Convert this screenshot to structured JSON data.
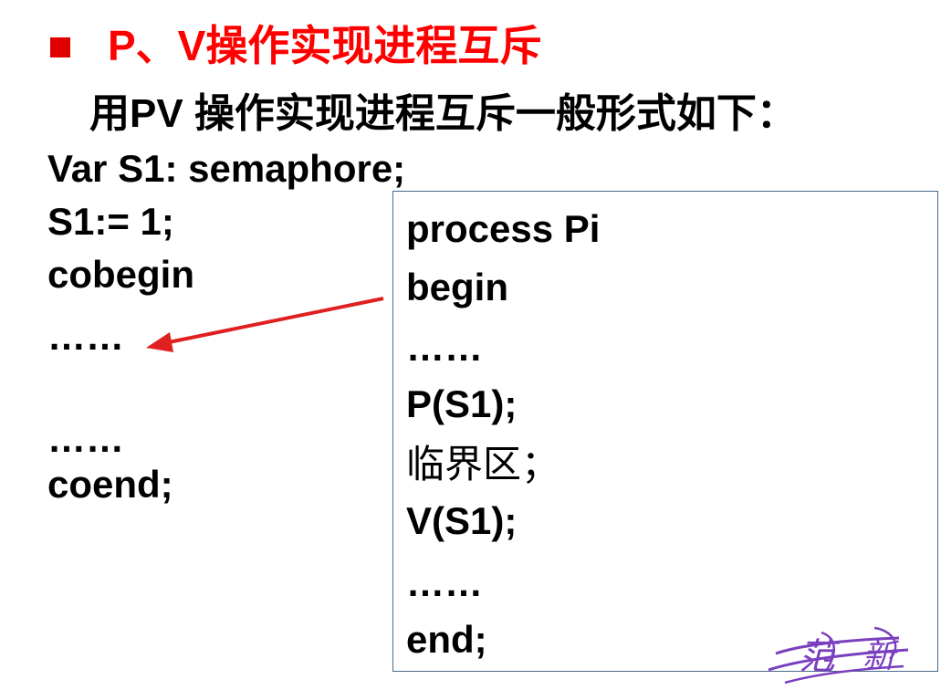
{
  "slide": {
    "bullet_color": "#e00000",
    "title": "P、V操作实现进程互斥",
    "title_color": "#ff0000",
    "subtitle": "用PV 操作实现进程互斥一般形式如下：",
    "left_code": [
      "Var S1: semaphore;",
      "S1:= 1;",
      "cobegin",
      "……",
      "……",
      "coend;"
    ],
    "box_code": [
      "process Pi",
      "begin",
      "……",
      "P(S1);",
      "临界区；",
      "V(S1);",
      "……",
      "end;"
    ],
    "arrow_color": "#e02020",
    "signature_text": "范新",
    "signature_color": "#7a3fbf"
  }
}
